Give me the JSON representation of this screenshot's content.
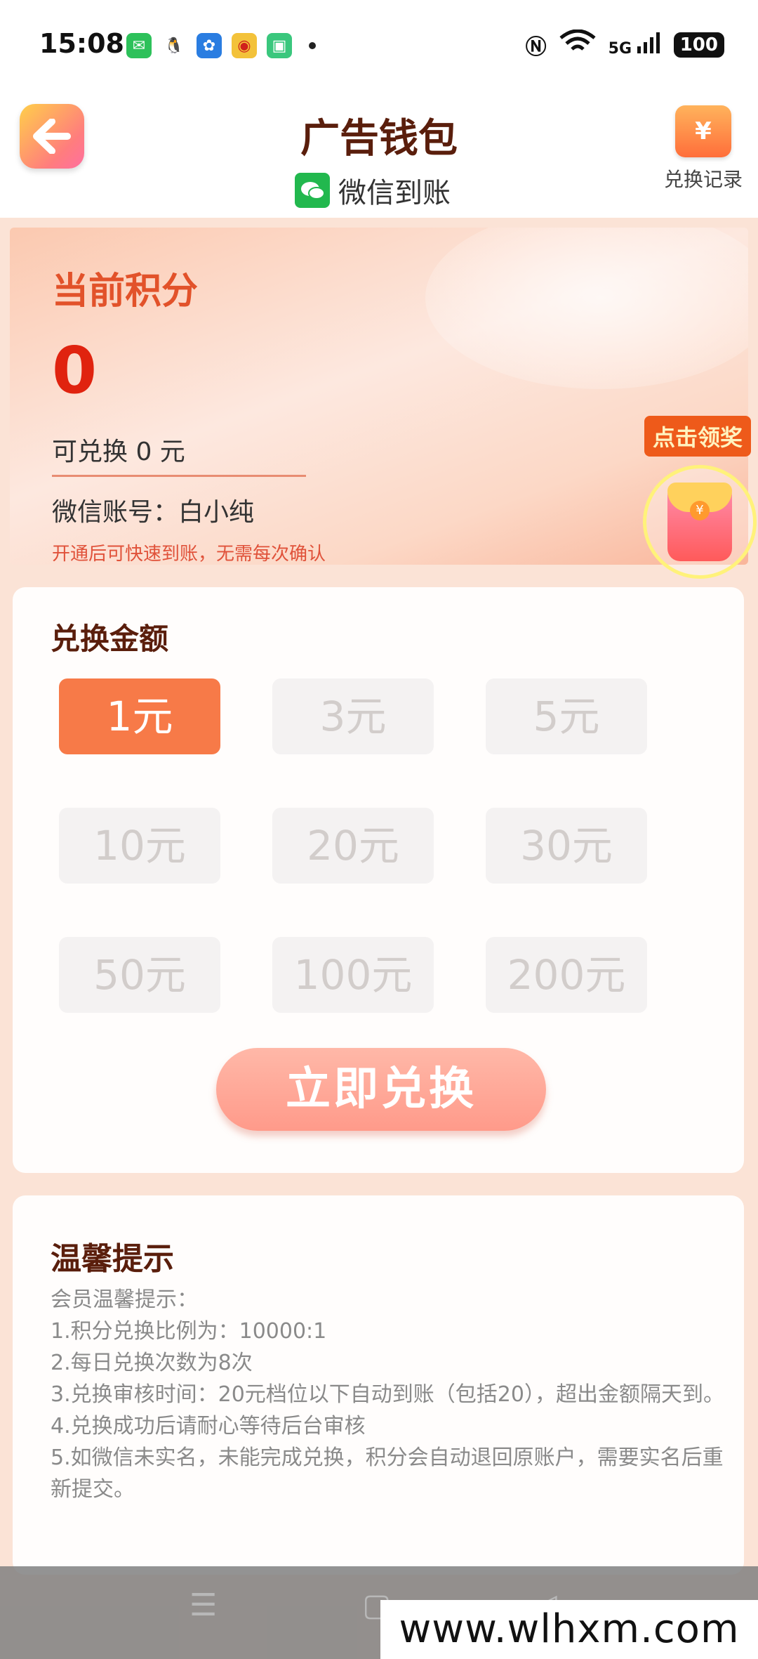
{
  "status_bar": {
    "time": "15:08",
    "apps": [
      {
        "name": "wechat-icon",
        "color": "#2dc15a",
        "glyph": "✉"
      },
      {
        "name": "qq-icon",
        "color": "#ffffff",
        "glyph": "🐧"
      },
      {
        "name": "fan-app-icon",
        "color": "#2a7de1",
        "glyph": "✿"
      },
      {
        "name": "weibo-icon",
        "color": "#f3c23a",
        "glyph": "◉"
      },
      {
        "name": "green-app-icon",
        "color": "#3ac77d",
        "glyph": "▣"
      }
    ],
    "network": "5G",
    "battery": "100"
  },
  "header": {
    "title": "广告钱包",
    "subtitle": "微信到账",
    "record_label": "兑换记录",
    "record_icon_glyph": "¥"
  },
  "points": {
    "label": "当前积分",
    "value": "0",
    "exchangeable": "可兑换 0 元",
    "account": "微信账号：白小纯",
    "note": "开通后可快速到账，无需每次确认"
  },
  "reward": {
    "badge": "点击领奖",
    "coin": "¥"
  },
  "exchange": {
    "title": "兑换金额",
    "amounts": [
      "1元",
      "3元",
      "5元",
      "10元",
      "20元",
      "30元",
      "50元",
      "100元",
      "200元"
    ],
    "selected": "1元",
    "button": "立即兑换"
  },
  "tips": {
    "title": "温馨提示",
    "lines": [
      "会员温馨提示：",
      "1.积分兑换比例为：10000:1",
      "2.每日兑换次数为8次",
      "3.兑换审核时间：20元档位以下自动到账（包括20），超出金额隔天到。",
      "4.兑换成功后请耐心等待后台审核",
      "5.如微信未实名，未能完成兑换，积分会自动退回原账户，需要实名后重新提交。"
    ]
  },
  "nav": {
    "menu_glyph": "☰",
    "home_glyph": "▢",
    "back_glyph": "◁"
  },
  "watermark": "www.wlhxm.com"
}
